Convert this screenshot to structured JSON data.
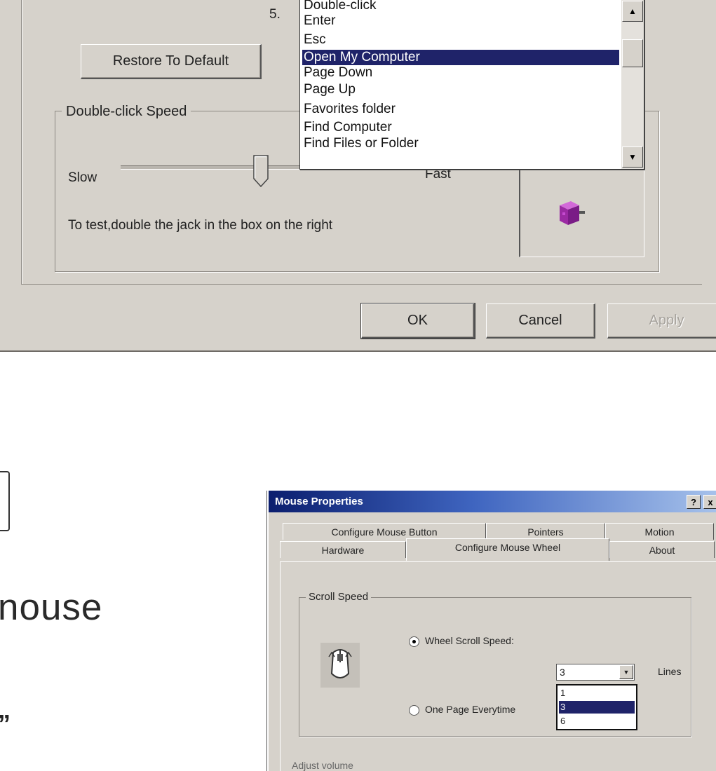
{
  "top_dialog": {
    "step_number": "5.",
    "restore_button": "Restore To Default",
    "list_items": [
      "Double-click",
      "Enter",
      "Esc",
      "Open My Computer",
      "Page Down",
      "Page Up",
      "Favorites folder",
      "Find Computer",
      "Find Files or Folder"
    ],
    "selected_item": "Open My Computer",
    "double_click_group": "Double-click Speed",
    "slow_label": "Slow",
    "fast_label": "Fast",
    "test_text": "To test,double the jack in the box on the right",
    "ok_button": "OK",
    "cancel_button": "Cancel",
    "apply_button": "Apply"
  },
  "left_text": {
    "big": "nouse",
    "quote": "”"
  },
  "mouse_properties": {
    "title": "Mouse Properties",
    "help_button": "?",
    "close_button": "x",
    "tabs_row1": [
      "Configure Mouse Button",
      "Pointers",
      "Motion"
    ],
    "tabs_row2": [
      "Hardware",
      "Configure Mouse Wheel",
      "About"
    ],
    "active_tab": "Configure Mouse Wheel",
    "scroll_group": "Scroll Speed",
    "radio_wheel": "Wheel Scroll Speed:",
    "radio_page": "One Page Everytime",
    "combo_value": "3",
    "lines_label": "Lines",
    "dropdown_options": [
      "1",
      "3",
      "6"
    ],
    "dropdown_selected": "3",
    "adjust_label": "Adjust volume"
  },
  "icons": [
    "up-arrow-icon",
    "down-arrow-icon",
    "jack-in-box-icon",
    "scroll-mouse-icon",
    "help-icon",
    "close-icon"
  ]
}
